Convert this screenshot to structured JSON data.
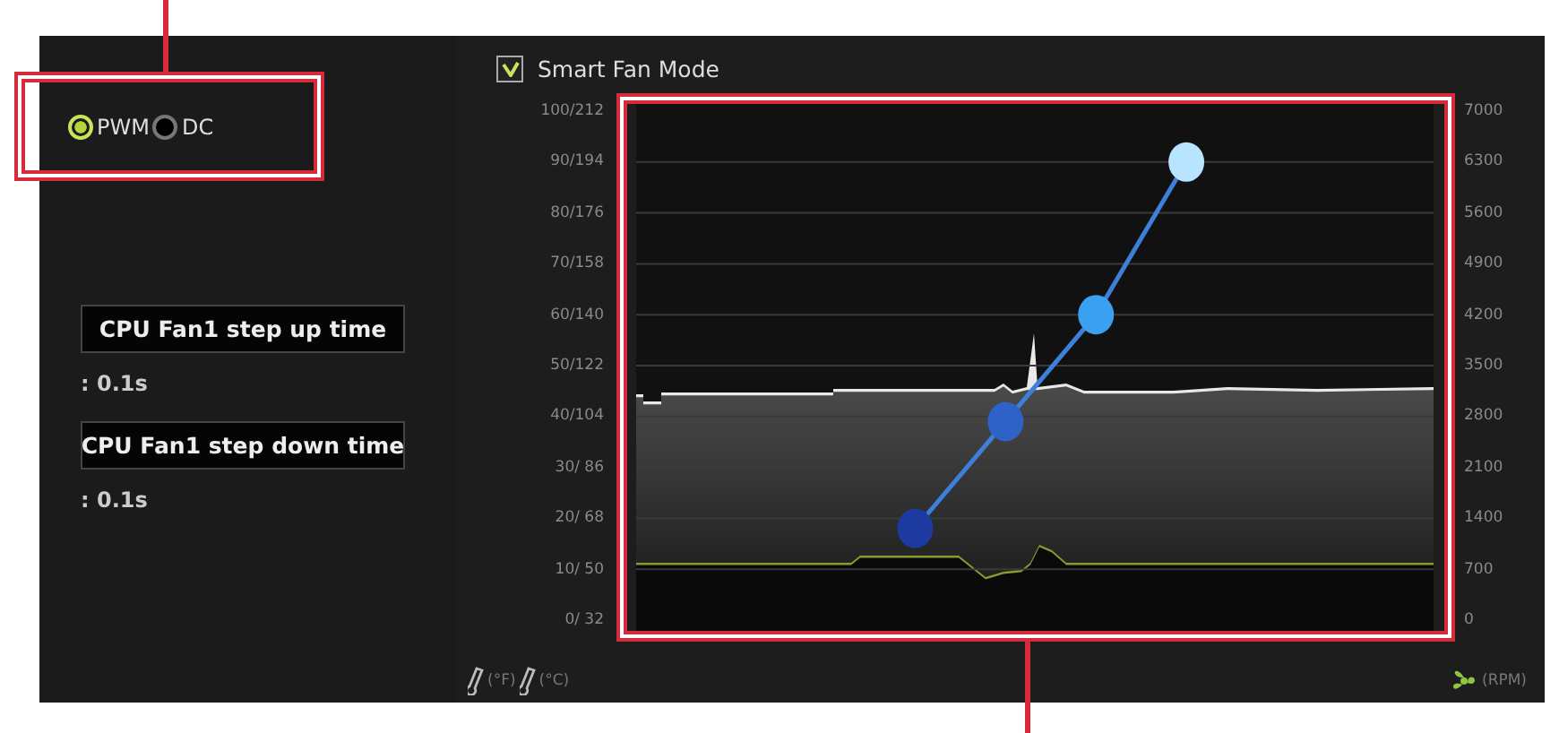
{
  "mode_options": [
    {
      "label": "PWM",
      "selected": true
    },
    {
      "label": "DC",
      "selected": false
    }
  ],
  "step_settings": [
    {
      "label": "CPU Fan1 step up time",
      "value": ": 0.1s"
    },
    {
      "label": "CPU Fan1 step down time",
      "value": ": 0.1s"
    }
  ],
  "smart_fan_mode": {
    "label": "Smart Fan Mode",
    "checked": true
  },
  "fan_curve": {
    "temperature_ticks": [
      "100/212",
      "90/194",
      "80/176",
      "70/158",
      "60/140",
      "50/122",
      "40/104",
      "30/ 86",
      "20/ 68",
      "10/ 50",
      "0/ 32"
    ]
  },
  "rpm_ticks": [
    "7000",
    "6300",
    "5600",
    "4900",
    "4200",
    "3500",
    "2800",
    "2100",
    "1400",
    "700",
    "0"
  ],
  "units": {
    "fahrenheit": "(°F)",
    "celsius": "(°C)",
    "rpm": "(RPM)"
  }
}
